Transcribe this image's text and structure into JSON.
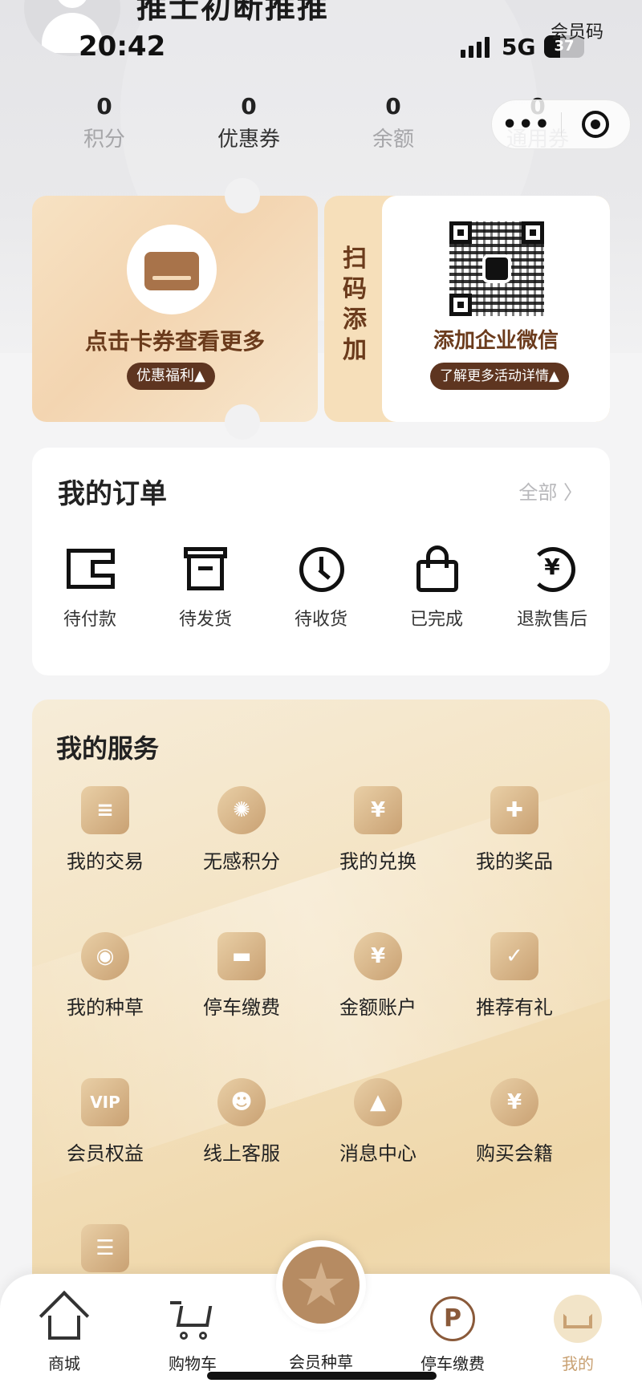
{
  "status_bar": {
    "time": "20:42",
    "network": "5G",
    "battery": "37"
  },
  "user": {
    "name": "推士初断推推"
  },
  "member_code_label": "会员码",
  "stats": [
    {
      "value": "0",
      "label": "积分"
    },
    {
      "value": "0",
      "label": "优惠券"
    },
    {
      "value": "0",
      "label": "余额"
    },
    {
      "value": "0",
      "label": "通用券"
    }
  ],
  "capsule": {
    "more": "•••"
  },
  "promo_left": {
    "title": "点击卡券查看更多",
    "pill": "优惠福利▲"
  },
  "promo_right": {
    "side_text": "扫码添加",
    "title": "添加企业微信",
    "pill": "了解更多活动详情▲"
  },
  "orders": {
    "title": "我的订单",
    "all_label": "全部 〉",
    "items": [
      {
        "label": "待付款",
        "icon": "wallet-icon"
      },
      {
        "label": "待发货",
        "icon": "box-icon"
      },
      {
        "label": "待收货",
        "icon": "clock-icon"
      },
      {
        "label": "已完成",
        "icon": "bag-icon"
      },
      {
        "label": "退款售后",
        "icon": "refund-icon"
      }
    ]
  },
  "services": {
    "title": "我的服务",
    "items": [
      {
        "label": "我的交易",
        "icon": "document-icon",
        "glyph": "≡"
      },
      {
        "label": "无感积分",
        "icon": "aperture-icon",
        "glyph": "✺"
      },
      {
        "label": "我的兑换",
        "icon": "ticket-icon",
        "glyph": "¥"
      },
      {
        "label": "我的奖品",
        "icon": "gift-icon",
        "glyph": "✚"
      },
      {
        "label": "我的种草",
        "icon": "planet-icon",
        "glyph": "◉"
      },
      {
        "label": "停车缴费",
        "icon": "car-icon",
        "glyph": "▬"
      },
      {
        "label": "金额账户",
        "icon": "yen-coin-icon",
        "glyph": "¥"
      },
      {
        "label": "推荐有礼",
        "icon": "thumbs-up-icon",
        "glyph": "✓"
      },
      {
        "label": "会员权益",
        "icon": "vip-icon",
        "glyph": "VIP"
      },
      {
        "label": "线上客服",
        "icon": "headset-icon",
        "glyph": "☻"
      },
      {
        "label": "消息中心",
        "icon": "bell-icon",
        "glyph": "▲"
      },
      {
        "label": "购买会籍",
        "icon": "yen-coin-icon",
        "glyph": "¥"
      },
      {
        "label": "",
        "icon": "id-card-icon",
        "glyph": "☰"
      }
    ]
  },
  "tabbar": {
    "items": [
      {
        "label": "商城",
        "icon": "home-icon"
      },
      {
        "label": "购物车",
        "icon": "cart-icon"
      },
      {
        "label": "会员种草",
        "icon": "star-icon"
      },
      {
        "label": "停车缴费",
        "icon": "parking-icon"
      },
      {
        "label": "我的",
        "icon": "crown-icon"
      }
    ]
  },
  "colors": {
    "accent": "#c9a173",
    "brown": "#6b3b1c",
    "pill": "#5e3520"
  }
}
